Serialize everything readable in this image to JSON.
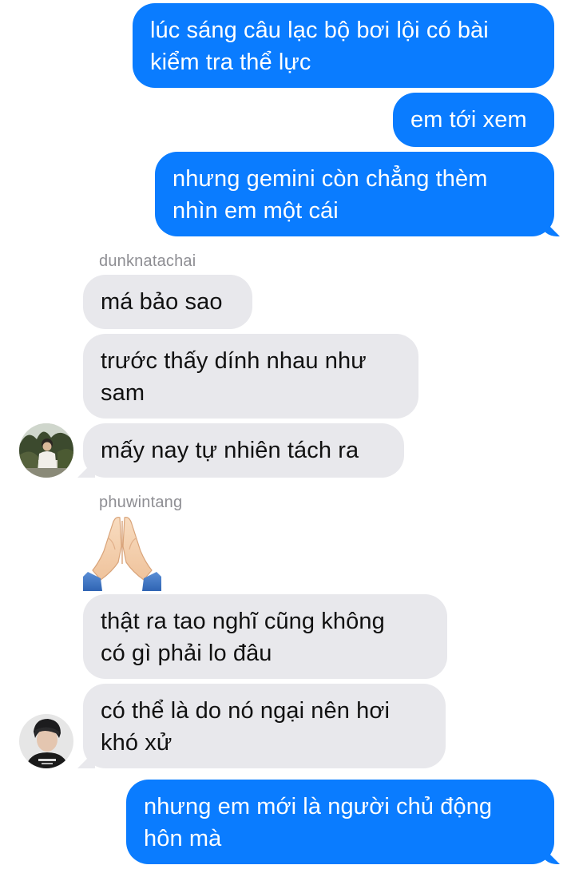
{
  "thread": {
    "messages": [
      {
        "text": "lúc sáng câu lạc bộ bơi lội có bài\nkiểm tra thể lực"
      },
      {
        "text": "em tới xem"
      },
      {
        "text": "nhưng gemini còn chẳng thèm\nnhìn em một cái"
      },
      {
        "sender": "dunknatachai"
      },
      {
        "text": "má bảo sao"
      },
      {
        "text": "trước thấy dính nhau như\nsam"
      },
      {
        "text": "mấy nay tự nhiên tách ra"
      },
      {
        "sender": "phuwintang"
      },
      {
        "emoji": "folded-hands"
      },
      {
        "text": "thật ra tao nghĩ cũng không\ncó gì phải lo đâu"
      },
      {
        "text": "có thể là do nó ngại nên hơi\nkhó xử"
      },
      {
        "text": "nhưng em mới là người chủ động\nhôn mà"
      }
    ]
  },
  "colors": {
    "sent_bubble": "#0a7cff",
    "received_bubble": "#e8e8ec",
    "sender_label": "#8e8e93"
  }
}
